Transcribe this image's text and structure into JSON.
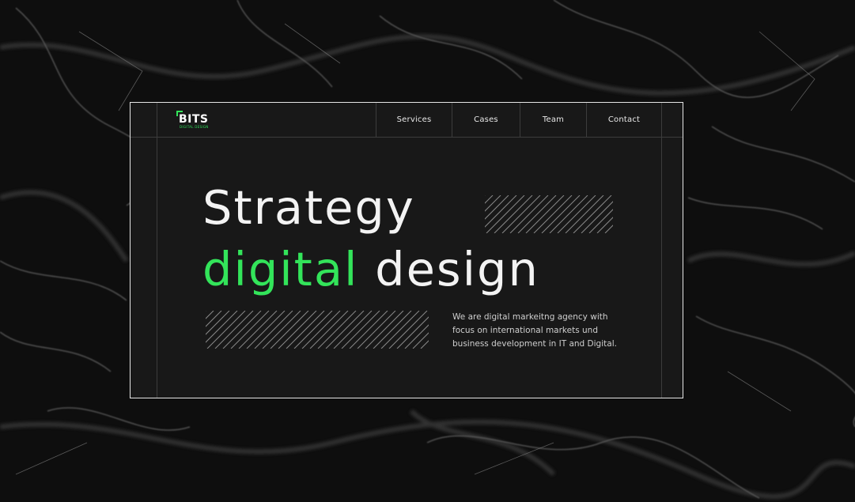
{
  "brand": {
    "name": "BITS",
    "subtitle": "DIGITAL DESIGN",
    "accent_color": "#33e45a"
  },
  "nav": {
    "items": [
      {
        "label": "Services"
      },
      {
        "label": "Cases"
      },
      {
        "label": "Team"
      },
      {
        "label": "Contact"
      }
    ]
  },
  "hero": {
    "line1": "Strategy",
    "line2_highlight": "digital",
    "line2_rest": "design",
    "description": "We are digital markeitng agency with focus on international markets und business development in IT and Digital."
  }
}
